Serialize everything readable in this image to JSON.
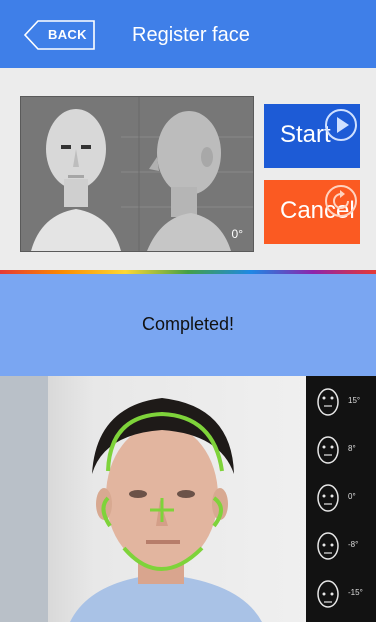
{
  "header": {
    "back_label": "BACK",
    "title": "Register face"
  },
  "model_view": {
    "degree": "0°"
  },
  "actions": {
    "start_label": "Start",
    "cancel_label": "Cancel"
  },
  "status": {
    "text": "Completed!"
  },
  "angle_guide": {
    "items": [
      {
        "label": "15°",
        "icon": "head-tilt-up-icon"
      },
      {
        "label": "8°",
        "icon": "head-slight-up-icon"
      },
      {
        "label": "0°",
        "icon": "head-front-icon"
      },
      {
        "label": "-8°",
        "icon": "head-slight-down-icon"
      },
      {
        "label": "-15°",
        "icon": "head-tilt-down-icon"
      }
    ]
  },
  "colors": {
    "header": "#3f7fe8",
    "start": "#1d5bd6",
    "cancel": "#fb5a22",
    "status": "#7aa6f2",
    "face_guide": "#7ed33a"
  }
}
